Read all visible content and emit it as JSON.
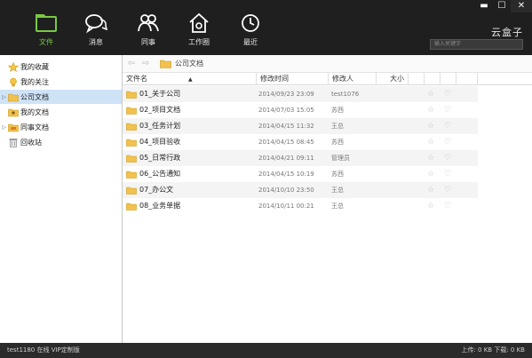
{
  "window": {
    "minimize": "▬",
    "maximize": "☐",
    "close": "✕"
  },
  "nav": [
    {
      "label": "文件",
      "icon": "folder-icon",
      "active": true
    },
    {
      "label": "消息",
      "icon": "chat-icon"
    },
    {
      "label": "同事",
      "icon": "colleagues-icon"
    },
    {
      "label": "工作圈",
      "icon": "work-circle-icon"
    },
    {
      "label": "最近",
      "icon": "clock-icon"
    }
  ],
  "brand": "云盒子",
  "search": {
    "placeholder": "输入关键字"
  },
  "sidebar": {
    "items": [
      {
        "label": "我的收藏",
        "icon": "star-icon"
      },
      {
        "label": "我的关注",
        "icon": "bulb-icon"
      },
      {
        "label": "公司文档",
        "icon": "folder-icon",
        "selected": true,
        "expandable": true
      },
      {
        "label": "我的文档",
        "icon": "my-docs-icon"
      },
      {
        "label": "同事文档",
        "icon": "shared-docs-icon",
        "expandable": true
      },
      {
        "label": "回收站",
        "icon": "trash-icon"
      }
    ]
  },
  "address": {
    "back": "⇦",
    "forward": "⇨",
    "path": "公司文档"
  },
  "columns": {
    "name": "文件名",
    "modified": "修改时间",
    "modifier": "修改人",
    "size": "大小"
  },
  "rows": [
    {
      "name": "01_关于公司",
      "modified": "2014/09/23 23:09",
      "modifier": "test1076"
    },
    {
      "name": "02_项目文档",
      "modified": "2014/07/03 15:05",
      "modifier": "苏西"
    },
    {
      "name": "03_任务计划",
      "modified": "2014/04/15 11:32",
      "modifier": "王总"
    },
    {
      "name": "04_项目验收",
      "modified": "2014/04/15 08:45",
      "modifier": "苏西"
    },
    {
      "name": "05_日常行政",
      "modified": "2014/04/21 09:11",
      "modifier": "管理员"
    },
    {
      "name": "06_公告通知",
      "modified": "2014/04/15 10:19",
      "modifier": "苏西"
    },
    {
      "name": "07_办公文",
      "modified": "2014/10/10 23:50",
      "modifier": "王总"
    },
    {
      "name": "08_业务单据",
      "modified": "2014/10/11 00:21",
      "modifier": "王总"
    }
  ],
  "row_icons": {
    "star": "☆",
    "pin": "♡"
  },
  "status": {
    "left": "test1180 在线  VIP定制版",
    "right": "上传: 0 KB    下载: 0 KB"
  },
  "colors": {
    "accent": "#7ac943",
    "topbar": "#1f1f1f",
    "selected": "#cfe3f7",
    "folder": "#f2c14e"
  }
}
